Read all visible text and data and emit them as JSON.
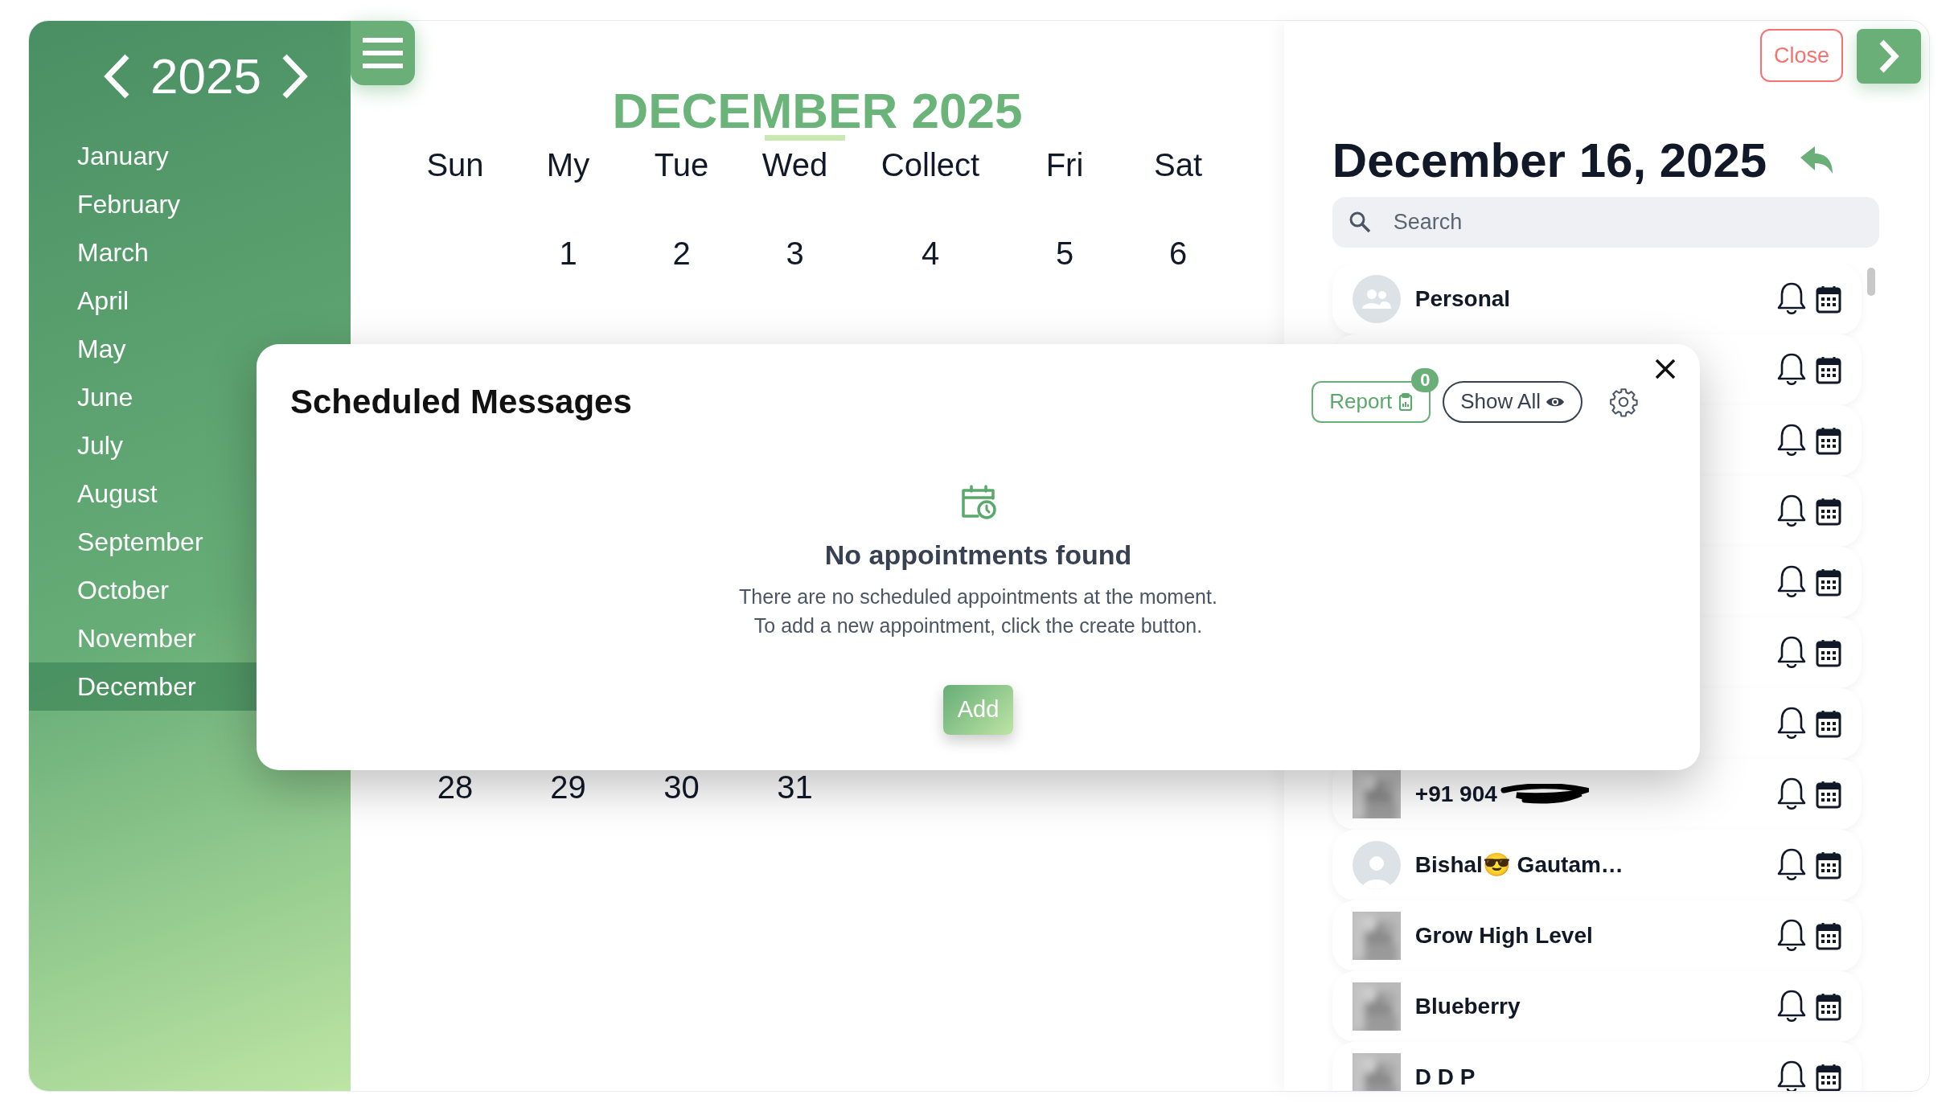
{
  "sidebar": {
    "year": "2025",
    "months": [
      {
        "label": "January",
        "selected": false
      },
      {
        "label": "February",
        "selected": false
      },
      {
        "label": "March",
        "selected": false
      },
      {
        "label": "April",
        "selected": false
      },
      {
        "label": "May",
        "selected": false
      },
      {
        "label": "June",
        "selected": false
      },
      {
        "label": "July",
        "selected": false
      },
      {
        "label": "August",
        "selected": false
      },
      {
        "label": "September",
        "selected": false
      },
      {
        "label": "October",
        "selected": false
      },
      {
        "label": "November",
        "selected": false
      },
      {
        "label": "December",
        "selected": true
      }
    ]
  },
  "calendar": {
    "title": "DECEMBER 2025",
    "weekdays": [
      "Sun",
      "My",
      "Tue",
      "Wed",
      "Collect",
      "Fri",
      "Sat"
    ],
    "first_week": [
      "1",
      "2",
      "3",
      "4",
      "5",
      "6"
    ],
    "last_week": [
      "28",
      "29",
      "30",
      "31"
    ]
  },
  "right_panel": {
    "close_label": "Close",
    "date_title": "December 16, 2025",
    "search": {
      "placeholder": "Search"
    },
    "contacts": [
      {
        "kind": "group",
        "name": "Personal",
        "redacted": false
      },
      {
        "kind": "covered"
      },
      {
        "kind": "covered"
      },
      {
        "kind": "covered"
      },
      {
        "kind": "covered"
      },
      {
        "kind": "covered"
      },
      {
        "kind": "covered"
      },
      {
        "name": "+91 904",
        "redacted": true
      },
      {
        "kind": "person",
        "name": "Bishal😎 Gautam…",
        "redacted": false
      },
      {
        "name": "Grow High Level",
        "redacted": false
      },
      {
        "name": "Blueberry",
        "redacted": false
      },
      {
        "name": "D D P",
        "redacted": false
      }
    ]
  },
  "modal": {
    "title": "Scheduled Messages",
    "report": {
      "label": "Report",
      "count": "0"
    },
    "show_all": "Show All",
    "empty_title": "No appointments found",
    "empty_lines": [
      "There are no scheduled appointments at the moment.",
      "To add a new appointment, click the create button."
    ],
    "add_label": "Add"
  }
}
